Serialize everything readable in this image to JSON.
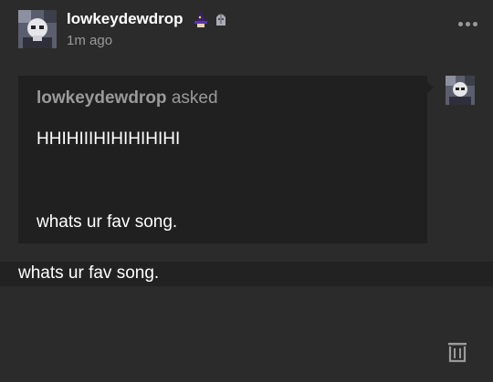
{
  "post": {
    "username": "lowkeydewdrop",
    "timestamp": "1m ago",
    "badges": [
      "wizard-hat-icon",
      "knight-helmet-icon"
    ]
  },
  "ask": {
    "asker_name": "lowkeydewdrop",
    "asked_label": "asked",
    "line1": "HHIHIIIHIHIHIHIHI",
    "line2": "whats ur fav song."
  },
  "answer": {
    "text": "whats ur fav song."
  },
  "colors": {
    "background": "#2b2b2b",
    "ask_box": "#202020",
    "muted_text": "#9a9a9a"
  }
}
